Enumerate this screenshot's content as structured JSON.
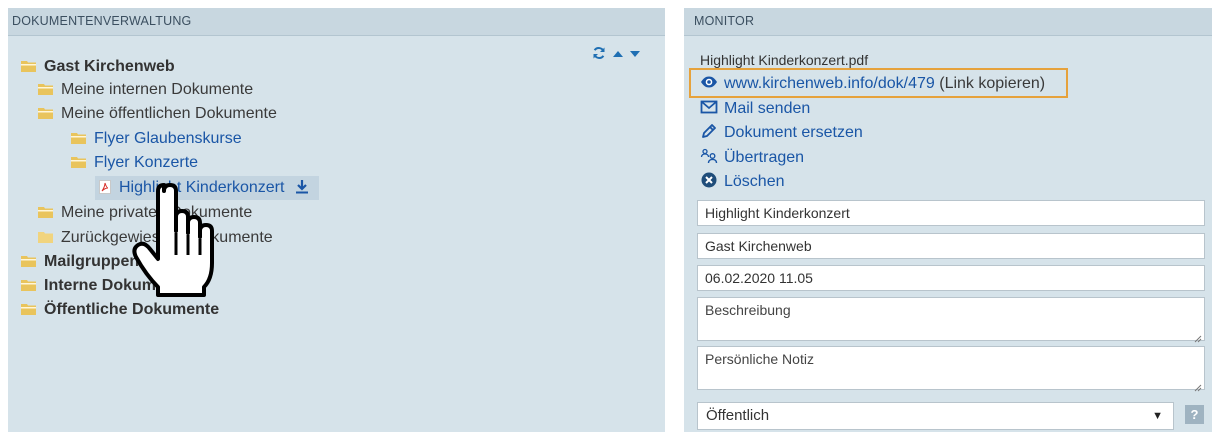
{
  "left_panel": {
    "title": "DOKUMENTENVERWALTUNG"
  },
  "tree": {
    "root": "Gast Kirchenweb",
    "internal": "Meine internen Dokumente",
    "public": "Meine öffentlichen Dokumente",
    "flyer_glauben": "Flyer Glaubenskurse",
    "flyer_konzerte": "Flyer Konzerte",
    "selected_file": "Highlight Kinderkonzert",
    "private": "Meine privaten Dokumente",
    "returned": "Zurückgewiesene Dokumente",
    "mailgroups": "Mailgruppen",
    "internal_docs": "Interne Dokumente",
    "public_docs": "Öffentliche Dokumente"
  },
  "right_panel": {
    "title": "MONITOR"
  },
  "monitor": {
    "filename": "Highlight Kinderkonzert.pdf",
    "link_url": "www.kirchenweb.info/dok/479",
    "link_copy": "(Link kopieren)",
    "mail": "Mail senden",
    "replace": "Dokument ersetzen",
    "transfer": "Übertragen",
    "delete": "Löschen",
    "title_value": "Highlight Kinderkonzert",
    "owner_value": "Gast Kirchenweb",
    "date_value": "06.02.2020 11.05",
    "description_placeholder": "Beschreibung",
    "note_placeholder": "Persönliche Notiz",
    "visibility": "Öffentlich",
    "help": "?"
  },
  "colors": {
    "accent": "#1a56a6",
    "highlight_border": "#e6a23c",
    "panel_bg": "#d6e3ea",
    "folder": "#e9c45c"
  }
}
